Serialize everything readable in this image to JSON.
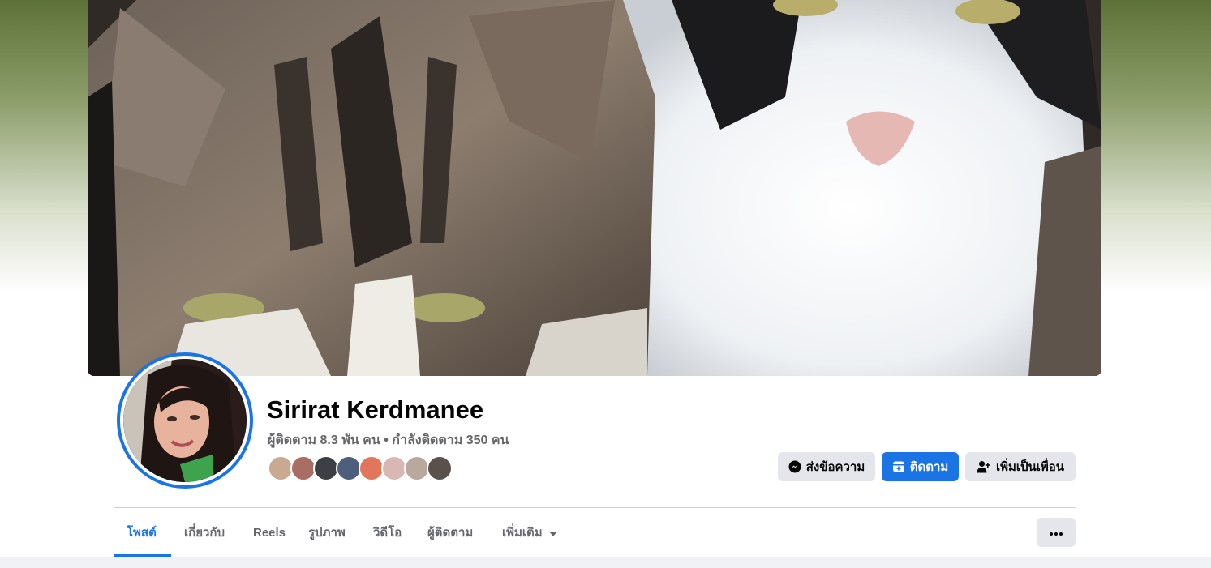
{
  "profile": {
    "name": "Sirirat Kerdmanee",
    "stats": "ผู้ติดตาม 8.3 พัน คน • กำลังติดตาม 350 คน"
  },
  "actions": {
    "message_label": "ส่งข้อความ",
    "follow_label": "ติดตาม",
    "add_friend_label": "เพิ่มเป็นเพื่อน"
  },
  "tabs": [
    {
      "label": "โพสต์",
      "active": true
    },
    {
      "label": "เกี่ยวกับ",
      "active": false
    },
    {
      "label": "Reels",
      "active": false
    },
    {
      "label": "รูปภาพ",
      "active": false
    },
    {
      "label": "วิดีโอ",
      "active": false
    },
    {
      "label": "ผู้ติดตาม",
      "active": false
    },
    {
      "label": "เพิ่มเติม",
      "active": false
    }
  ],
  "icons": {
    "message": "messenger-icon",
    "follow": "follow-icon",
    "add_friend": "add-friend-icon",
    "more_tab": "caret-down-icon",
    "more_options": "ellipsis-icon"
  },
  "colors": {
    "accent": "#1b74e4",
    "button_gray": "#e4e6eb",
    "text_primary": "#050505",
    "text_secondary": "#65676b"
  }
}
